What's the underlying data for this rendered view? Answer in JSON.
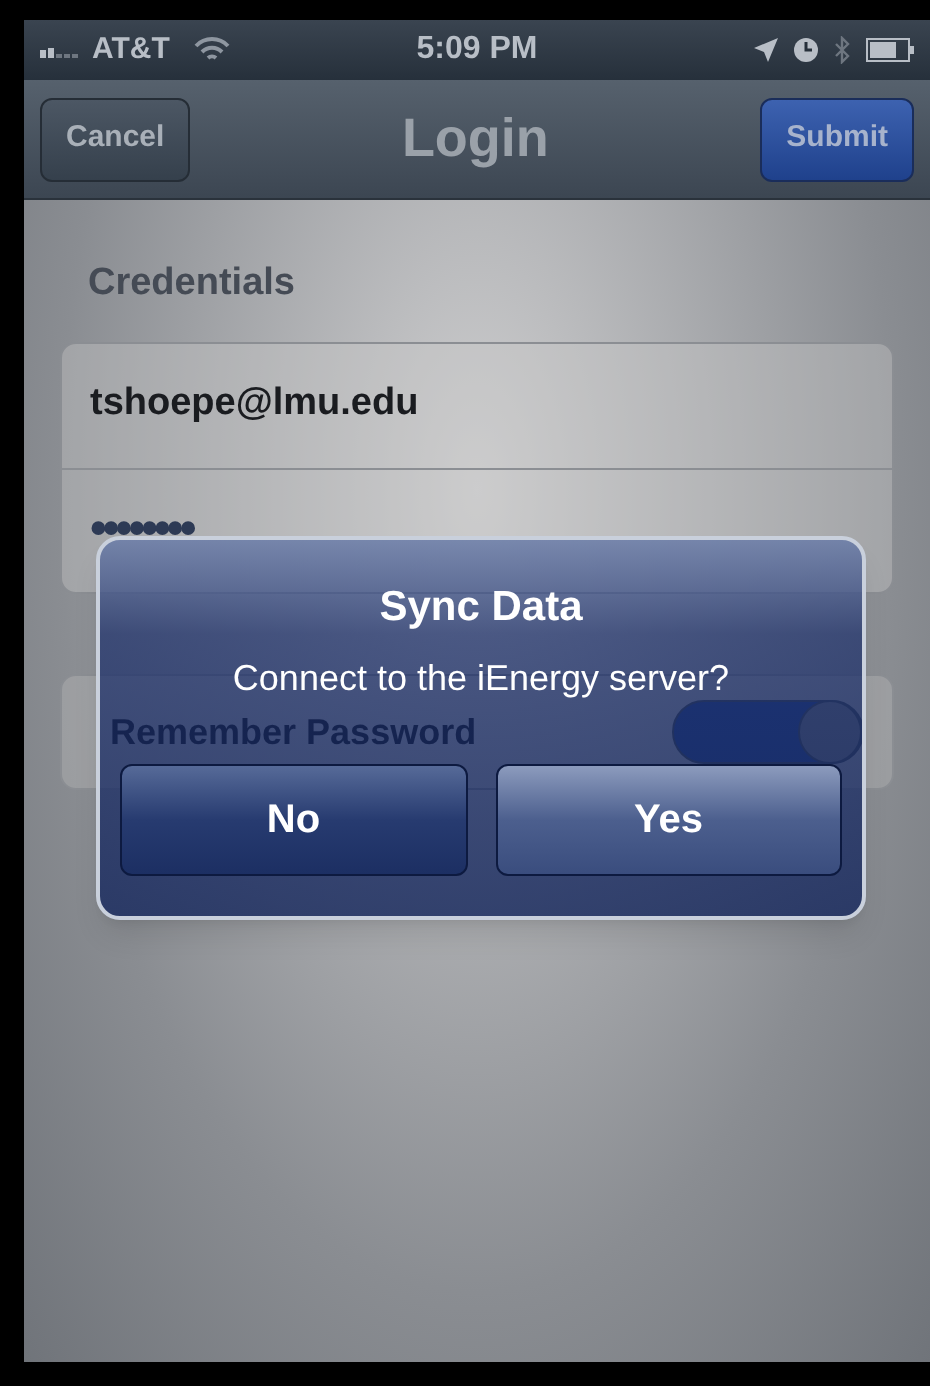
{
  "status_bar": {
    "carrier": "AT&T",
    "time": "5:09 PM"
  },
  "nav_bar": {
    "title": "Login",
    "left_button": "Cancel",
    "right_button": "Submit"
  },
  "section": {
    "header": "Credentials"
  },
  "fields": [
    {
      "kind": "text",
      "value": "tshoepe@lmu.edu"
    },
    {
      "kind": "password",
      "value": "••••••••"
    }
  ],
  "remember_row": {
    "label": "Remember Password",
    "on": true
  },
  "alert": {
    "title": "Sync Data",
    "message": "Connect to the iEnergy server?",
    "buttons": [
      "No",
      "Yes"
    ]
  }
}
